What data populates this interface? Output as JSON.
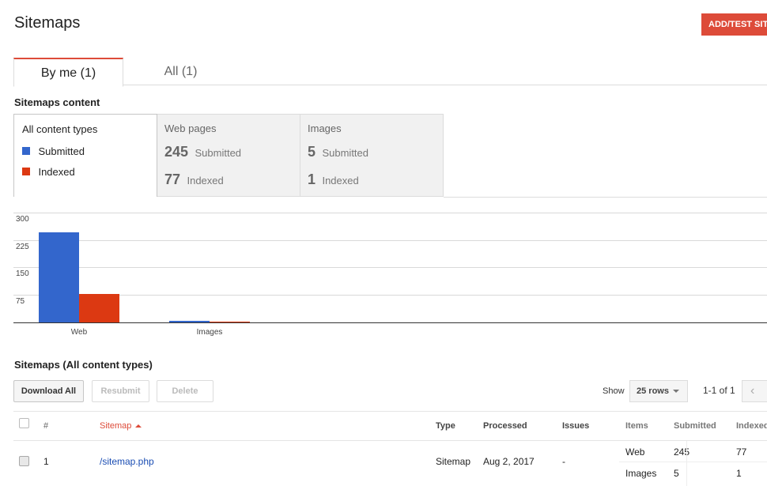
{
  "header": {
    "title": "Sitemaps",
    "add_button": "ADD/TEST SITEMAP"
  },
  "tabs": [
    {
      "label": "By me (1)"
    },
    {
      "label": "All (1)"
    }
  ],
  "content_section": {
    "title": "Sitemaps content",
    "all_box": {
      "title": "All content types",
      "legend": [
        {
          "label": "Submitted",
          "color": "#3366cc"
        },
        {
          "label": "Indexed",
          "color": "#dc3912"
        }
      ]
    },
    "web_box": {
      "title": "Web pages",
      "submitted_value": "245",
      "submitted_label": "Submitted",
      "indexed_value": "77",
      "indexed_label": "Indexed"
    },
    "images_box": {
      "title": "Images",
      "submitted_value": "5",
      "submitted_label": "Submitted",
      "indexed_value": "1",
      "indexed_label": "Indexed"
    }
  },
  "chart_data": {
    "type": "bar",
    "categories": [
      "Web",
      "Images"
    ],
    "series": [
      {
        "name": "Submitted",
        "values": [
          245,
          5
        ],
        "color": "#3366cc"
      },
      {
        "name": "Indexed",
        "values": [
          77,
          1
        ],
        "color": "#dc3912"
      }
    ],
    "ylim": [
      0,
      300
    ],
    "yticks": [
      "300",
      "225",
      "150",
      "75"
    ],
    "grid": true
  },
  "table_section": {
    "title": "Sitemaps (All content types)",
    "buttons": {
      "download": "Download All",
      "resubmit": "Resubmit",
      "delete": "Delete"
    },
    "show_label": "Show",
    "rows_select": "25 rows",
    "range": "1-1 of 1",
    "headers": {
      "num": "#",
      "sitemap": "Sitemap",
      "type": "Type",
      "processed": "Processed",
      "issues": "Issues",
      "items": "Items",
      "submitted": "Submitted",
      "indexed": "Indexed"
    },
    "rows": [
      {
        "num": "1",
        "sitemap": "/sitemap.php",
        "type": "Sitemap",
        "processed": "Aug 2, 2017",
        "issues": "-",
        "items": [
          {
            "item": "Web",
            "submitted": "245",
            "indexed": "77"
          },
          {
            "item": "Images",
            "submitted": "5",
            "indexed": "1"
          }
        ]
      }
    ]
  }
}
